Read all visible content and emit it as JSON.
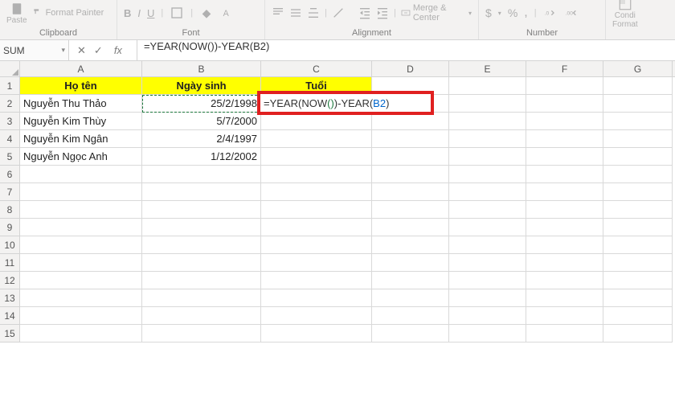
{
  "ribbon": {
    "paste_label": "Paste",
    "format_painter": "Format Painter",
    "clipboard_label": "Clipboard",
    "font_label": "Font",
    "alignment_label": "Alignment",
    "merge_center": "Merge & Center",
    "number_label": "Number",
    "currency_symbol": "$",
    "percent_symbol": "%",
    "condi": "Condi",
    "format": "Format",
    "bold": "B",
    "italic": "I",
    "underline": "U"
  },
  "formula_bar": {
    "name_box": "SUM",
    "fx": "fx",
    "formula": "=YEAR(NOW())-YEAR(B2)"
  },
  "columns": [
    "A",
    "B",
    "C",
    "D",
    "E",
    "F",
    "G"
  ],
  "row_numbers": [
    1,
    2,
    3,
    4,
    5,
    6,
    7,
    8,
    9,
    10,
    11,
    12,
    13,
    14,
    15
  ],
  "headers": {
    "col_a": "Họ tên",
    "col_b": "Ngày sinh",
    "col_c": "Tuổi"
  },
  "data_rows": [
    {
      "name": "Nguyễn Thu Thảo",
      "date": "25/2/1998"
    },
    {
      "name": "Nguyễn Kim Thùy",
      "date": "5/7/2000"
    },
    {
      "name": "Nguyễn Kim Ngân",
      "date": "2/4/1997"
    },
    {
      "name": "Nguyễn Ngọc Anh",
      "date": "1/12/2002"
    }
  ],
  "active_formula": {
    "prefix": "=YEAR(NOW",
    "paren_open": "(",
    "paren_close": ")",
    "mid": ")-YEAR(",
    "ref": "B2",
    "end": ")"
  }
}
